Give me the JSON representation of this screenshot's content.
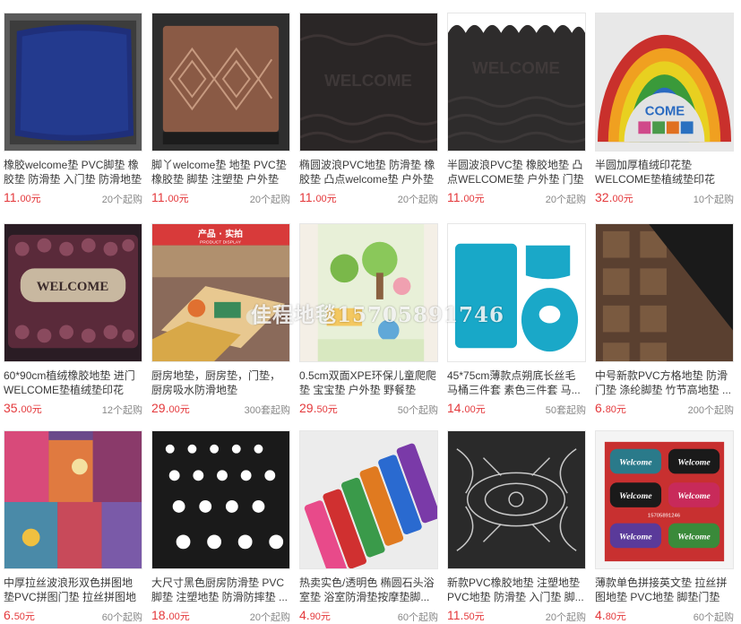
{
  "products": [
    {
      "title": "橡胶welcome垫 PVC脚垫 橡胶垫 防滑垫 入门垫 防滑地垫",
      "price_int": "11.",
      "price_dec": "00元",
      "moq": "20个起购",
      "icon": "blue-doormat"
    },
    {
      "title": "脚丫welcome垫 地垫 PVC垫 橡胶垫 脚垫 注塑垫 户外垫",
      "price_int": "11.",
      "price_dec": "00元",
      "moq": "20个起购",
      "icon": "diamond-pattern-doormat"
    },
    {
      "title": "椭圆波浪PVC地垫 防滑垫 橡胶垫 凸点welcome垫 户外垫",
      "price_int": "11.",
      "price_dec": "00元",
      "moq": "20个起购",
      "icon": "welcome-wave-doormat"
    },
    {
      "title": "半圆波浪PVC垫 橡胶地垫 凸点WELCOME垫 户外垫 门垫",
      "price_int": "11.",
      "price_dec": "00元",
      "moq": "20个起购",
      "icon": "semicircle-wave-doormat"
    },
    {
      "title": "半圆加厚植绒印花垫 WELCOME垫植绒垫印花脚...",
      "price_int": "32.",
      "price_dec": "00元",
      "moq": "10个起购",
      "icon": "rainbow-welcome-mat"
    },
    {
      "title": "60*90cm植绒橡胶地垫 进门WELCOME垫植绒垫印花垫...",
      "price_int": "35.",
      "price_dec": "00元",
      "moq": "12个起购",
      "icon": "floral-welcome-mat"
    },
    {
      "title": "厨房地垫，厨房垫，门垫，厨房吸水防滑地垫",
      "price_int": "29.",
      "price_dec": "00元",
      "moq": "300套起购",
      "icon": "kitchen-mat"
    },
    {
      "title": "0.5cm双面XPE环保儿童爬爬垫 宝宝垫 户外垫 野餐垫",
      "price_int": "29.",
      "price_dec": "50元",
      "moq": "50个起购",
      "icon": "kids-play-mat"
    },
    {
      "title": "45*75cm薄款点朔底长丝毛马桶三件套 素色三件套 马...",
      "price_int": "14.",
      "price_dec": "00元",
      "moq": "50套起购",
      "icon": "bath-mat-set"
    },
    {
      "title": "中号新款PVC方格地垫 防滑门垫 涤纶脚垫 竹节高地垫 ...",
      "price_int": "6.",
      "price_dec": "80元",
      "moq": "200个起购",
      "icon": "pvc-grid-mat"
    },
    {
      "title": "中厚拉丝波浪形双色拼图地垫PVC拼图门垫 拉丝拼图地垫",
      "price_int": "6.",
      "price_dec": "50元",
      "moq": "60个起购",
      "icon": "puzzle-mat-stack"
    },
    {
      "title": "大尺寸黑色厨房防滑垫 PVC脚垫 注塑地垫 防滑防摔垫 ...",
      "price_int": "18.",
      "price_dec": "00元",
      "moq": "20个起购",
      "icon": "black-hole-mat"
    },
    {
      "title": "热卖实色/透明色 椭圆石头浴室垫 浴室防滑垫按摩垫脚...",
      "price_int": "4.",
      "price_dec": "90元",
      "moq": "60个起购",
      "icon": "bath-pebble-mat"
    },
    {
      "title": "新款PVC橡胶地垫 注塑地垫 PVC地垫 防滑垫 入门垫 脚...",
      "price_int": "11.",
      "price_dec": "50元",
      "moq": "20个起购",
      "icon": "lace-pattern-mat"
    },
    {
      "title": "薄款单色拼接英文垫 拉丝拼图地垫 PVC地垫 脚垫门垫",
      "price_int": "4.",
      "price_dec": "80元",
      "moq": "60个起购",
      "icon": "welcome-color-mats"
    }
  ],
  "images_text": {
    "welcome": "WELCOME",
    "come": "COME",
    "welcome_small": "Welcome",
    "kitchen_banner": "产品 · 实拍",
    "kitchen_sub": "PRODUCT DISPLAY",
    "mat_phone": "15705891246"
  },
  "watermark": "佳程地毯15705891746"
}
